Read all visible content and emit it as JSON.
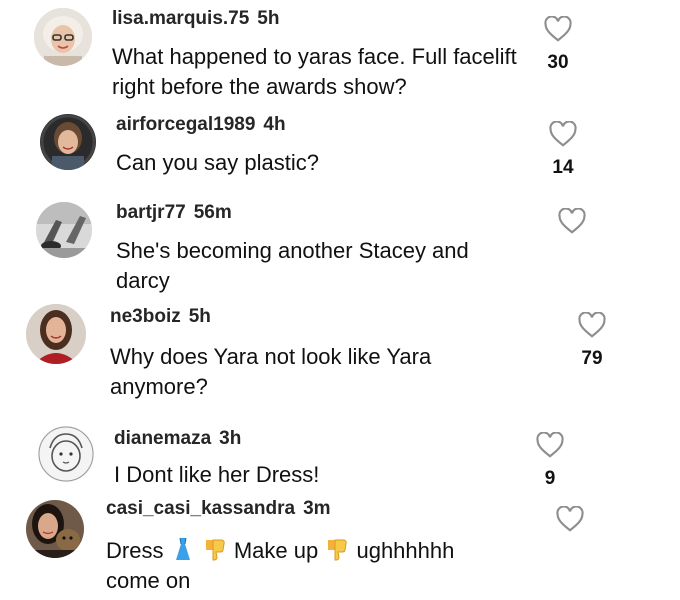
{
  "comments": [
    {
      "username": "lisa.marquis.75",
      "time": "5h",
      "text": "What happened to yaras face. Full facelift right before the awards show?",
      "likes": "30",
      "icon": "heart-icon"
    },
    {
      "username": "airforcegal1989",
      "time": "4h",
      "text": "Can you say plastic?",
      "likes": "14",
      "icon": "heart-icon"
    },
    {
      "username": "bartjr77",
      "time": "56m",
      "text": "She's becoming another Stacey and darcy",
      "likes": "",
      "icon": "heart-icon"
    },
    {
      "username": "ne3boiz",
      "time": "5h",
      "text": "Why does Yara not look like Yara anymore?",
      "likes": "79",
      "icon": "heart-icon"
    },
    {
      "username": "dianemaza",
      "time": "3h",
      "text": "I Dont like her Dress!",
      "likes": "9",
      "icon": "heart-icon"
    },
    {
      "username": "casi_casi_kassandra",
      "time": "3m",
      "text_parts": {
        "a": "Dress",
        "b": "Make up",
        "c": "ughhhhhh",
        "d": "come on"
      },
      "emojis": [
        "dress-emoji",
        "thumbs-down-emoji",
        "thumbs-down-emoji"
      ],
      "likes": "",
      "icon": "heart-icon"
    }
  ],
  "colors": {
    "text": "#111111",
    "username": "#262626",
    "heart_stroke": "#8e8e8e"
  }
}
